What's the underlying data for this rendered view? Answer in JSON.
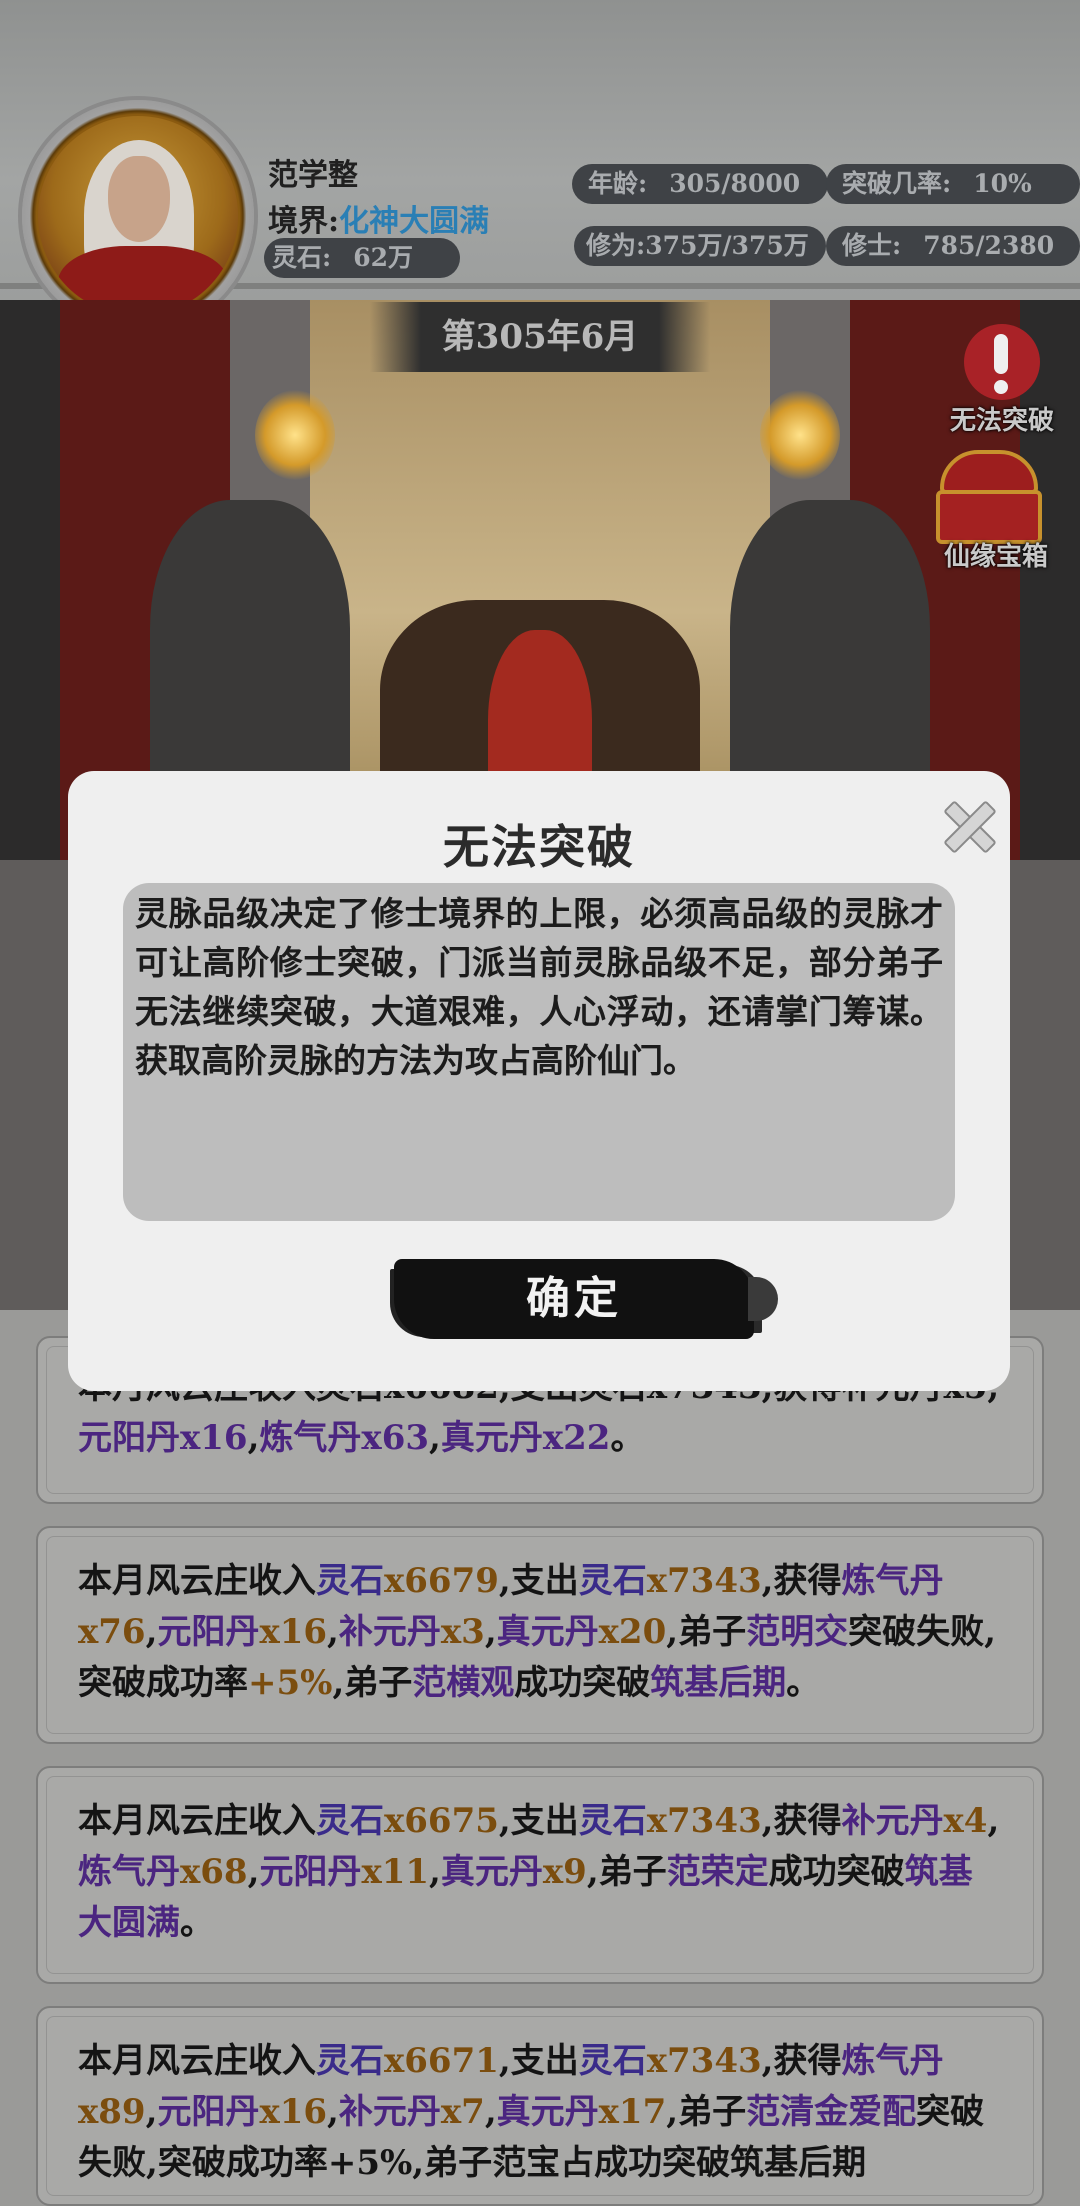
{
  "header": {
    "player_name": "范学整",
    "realm_label": "境界:",
    "realm_value": "化神大圆满",
    "spirit_stone_label": "灵石:",
    "spirit_stone_value": "62万",
    "age_label": "年龄:",
    "age_value": "305/8000",
    "breakthrough_rate_label": "突破几率:",
    "breakthrough_rate_value": "10%",
    "cultivation_label": "修为:",
    "cultivation_value": "375万/375万",
    "disciples_label": "修士:",
    "disciples_value": "785/2380"
  },
  "scene": {
    "date": "第305年6月",
    "alert_label": "无法突破",
    "chest_label": "仙缘宝箱"
  },
  "dialog": {
    "title": "无法突破",
    "body": "灵脉品级决定了修士境界的上限，必须高品级的灵脉才可让高阶修士突破，门派当前灵脉品级不足，部分弟子无法继续突破，大道艰难，人心浮动，还请掌门筹谋。获取高阶灵脉的方法为攻占高阶仙门。",
    "confirm": "确定"
  },
  "log": {
    "card1": {
      "line1": "本月风云庄收入灵石x6682,支出灵石x7343,获得补元丹x5,",
      "p1": "元阳丹x16",
      "s1": ",",
      "p2": "炼气丹x63",
      "s2": ",",
      "p3": "真元丹x22",
      "s3": "。"
    },
    "card2": {
      "a": "本月风云庄收入",
      "b": "灵石",
      "c": "x6679",
      "d": ",支出",
      "e": "灵石",
      "f": "x7343",
      "g": ",获得",
      "h": "炼气丹",
      "i": "x76",
      "j": ",",
      "k": "元阳丹",
      "l": "x16",
      "m": ",",
      "n": "补元丹",
      "o": "x3",
      "p": ",",
      "q": "真元丹",
      "r": "x20",
      "s": ",弟子",
      "t": "范明交",
      "u": "突破失败,突破成功率",
      "v": "+5%",
      "w": ",弟子",
      "x": "范横观",
      "y": "成功突破",
      "z": "筑基后期",
      "end": "。"
    },
    "card3": {
      "a": "本月风云庄收入",
      "b": "灵石",
      "c": "x6675",
      "d": ",支出",
      "e": "灵石",
      "f": "x7343",
      "g": ",获得",
      "h": "补元丹",
      "i": "x4",
      "j": ",",
      "k": "炼气丹",
      "l": "x68",
      "m": ",",
      "n": "元阳丹",
      "o": "x11",
      "p": ",",
      "q": "真元丹",
      "r": "x9",
      "s": ",弟子",
      "t": "范荣定",
      "u": "成功突破",
      "v": "筑基大圆满",
      "end": "。"
    },
    "card4": {
      "a": "本月风云庄收入",
      "b": "灵石",
      "c": "x6671",
      "d": ",支出",
      "e": "灵石",
      "f": "x7343",
      "g": ",获得",
      "h": "炼气丹",
      "i": "x89",
      "j": ",",
      "k": "元阳丹",
      "l": "x16",
      "m": ",",
      "n": "补元丹",
      "o": "x7",
      "p": ",",
      "q": "真元丹",
      "r": "x17",
      "s": ",弟子",
      "t": "范清金爱配",
      "u": "突破失败,突破成功率+5%,弟子范宝占成功突破筑基后期"
    }
  },
  "colors": {
    "realm": "#2a7fb5",
    "resource_name": "#3a2b8a",
    "resource_amount": "#7b4d0e",
    "item_purple": "#4b2580",
    "dialog_bg": "#efefef",
    "alert_red": "#a92227"
  },
  "icons": [
    "character-portrait",
    "alert-exclamation-icon",
    "treasure-chest-icon",
    "close-icon"
  ]
}
